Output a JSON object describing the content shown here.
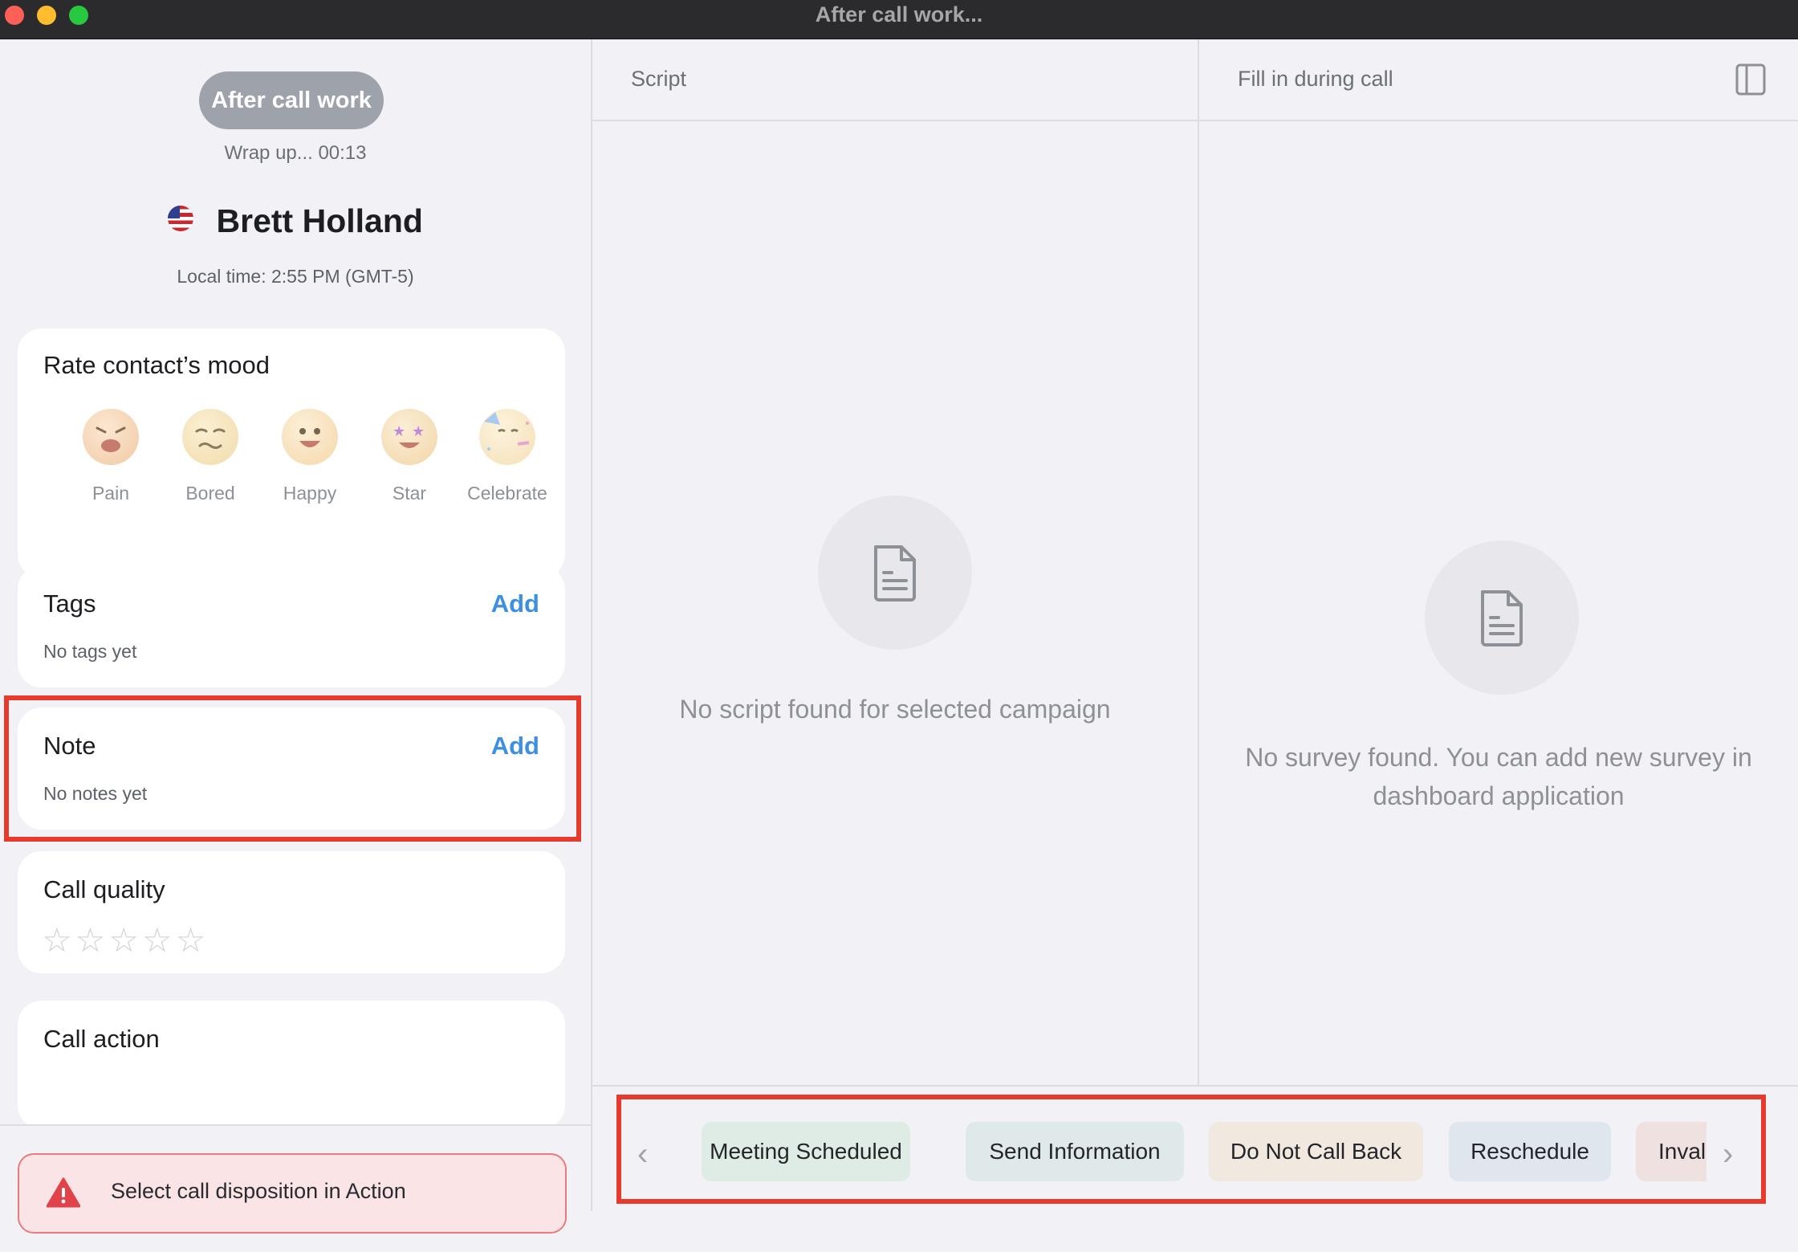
{
  "window": {
    "title": "After call work..."
  },
  "status": {
    "pill_label": "After call work",
    "wrapup": "Wrap up... 00:13"
  },
  "contact": {
    "name": "Brett Holland",
    "local_time": "Local time: 2:55 PM (GMT-5)"
  },
  "mood": {
    "title": "Rate contact’s mood",
    "options": [
      {
        "label": "Pain",
        "icon": "pain-face-icon"
      },
      {
        "label": "Bored",
        "icon": "bored-face-icon"
      },
      {
        "label": "Happy",
        "icon": "happy-face-icon"
      },
      {
        "label": "Star",
        "icon": "star-eyes-face-icon"
      },
      {
        "label": "Celebrate",
        "icon": "party-face-icon"
      }
    ]
  },
  "tags": {
    "title": "Tags",
    "add_label": "Add",
    "empty": "No tags yet"
  },
  "note": {
    "title": "Note",
    "add_label": "Add",
    "empty": "No notes yet"
  },
  "call_quality": {
    "title": "Call quality",
    "rating": 0,
    "max_rating": 5
  },
  "call_action": {
    "title": "Call action"
  },
  "alert": {
    "text": "Select call disposition in Action",
    "icon": "warning-icon"
  },
  "script": {
    "header": "Script",
    "empty": "No script found for selected campaign"
  },
  "survey": {
    "header": "Fill in during call",
    "empty": "No survey found. You can add new survey in dashboard application"
  },
  "dispositions": [
    {
      "label": "Meeting Scheduled",
      "color": "#dfece5"
    },
    {
      "label": "Send Information",
      "color": "#dfe9e9"
    },
    {
      "label": "Do Not Call Back",
      "color": "#f1e8df"
    },
    {
      "label": "Reschedule",
      "color": "#dfe6ee"
    },
    {
      "label": "Invalid Nu",
      "color": "#f0e1e1"
    }
  ],
  "colors": {
    "accent": "#3d8fe0",
    "highlight": "#e63a2c",
    "alert_bg": "#fbe4e6"
  }
}
